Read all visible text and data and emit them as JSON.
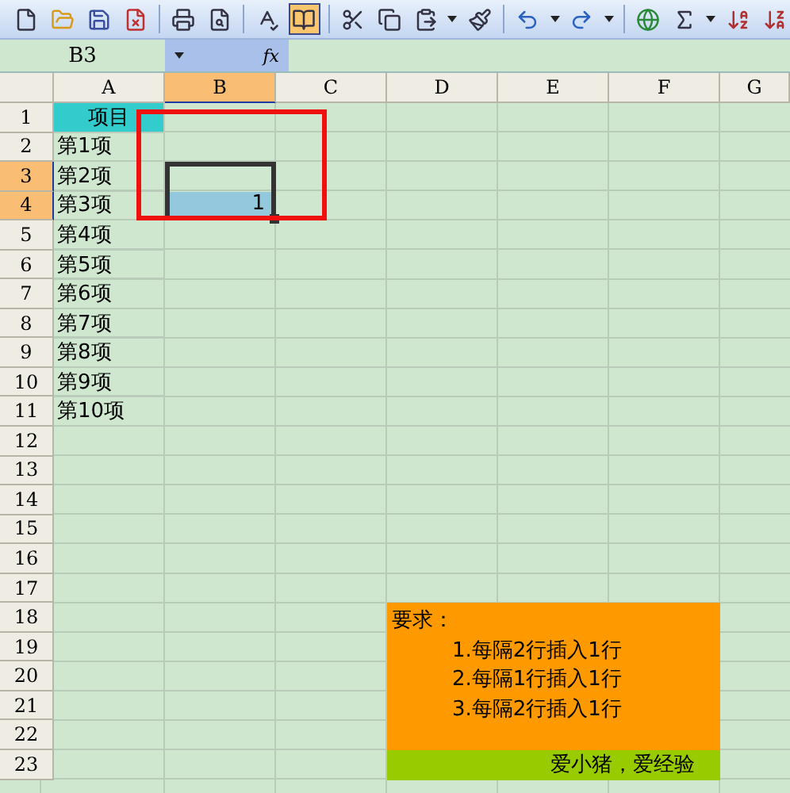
{
  "toolbar": [
    {
      "kind": "new",
      "pressed": false
    },
    {
      "kind": "open",
      "pressed": false
    },
    {
      "kind": "save",
      "pressed": false
    },
    {
      "kind": "permission",
      "pressed": false
    },
    {
      "kind": "separator"
    },
    {
      "kind": "print",
      "pressed": false
    },
    {
      "kind": "preview",
      "pressed": false
    },
    {
      "kind": "separator"
    },
    {
      "kind": "spelling",
      "pressed": false
    },
    {
      "kind": "research",
      "pressed": true
    },
    {
      "kind": "separator"
    },
    {
      "kind": "cut",
      "pressed": false
    },
    {
      "kind": "copy",
      "pressed": false
    },
    {
      "kind": "paste",
      "pressed": false
    },
    {
      "kind": "dropdown"
    },
    {
      "kind": "format_painter",
      "pressed": false
    },
    {
      "kind": "separator"
    },
    {
      "kind": "undo",
      "pressed": false
    },
    {
      "kind": "dropdown"
    },
    {
      "kind": "redo",
      "pressed": false
    },
    {
      "kind": "dropdown"
    },
    {
      "kind": "separator"
    },
    {
      "kind": "hyperlink",
      "pressed": false
    },
    {
      "kind": "autosum",
      "pressed": false
    },
    {
      "kind": "dropdown"
    },
    {
      "kind": "sort_asc",
      "pressed": false
    },
    {
      "kind": "sort_desc",
      "pressed": false
    }
  ],
  "formula_bar": {
    "name_box": "B3",
    "fx": "fx"
  },
  "columns": [
    {
      "label": "A",
      "selected": false
    },
    {
      "label": "B",
      "selected": true
    },
    {
      "label": "C",
      "selected": false
    },
    {
      "label": "D",
      "selected": false
    },
    {
      "label": "E",
      "selected": false
    },
    {
      "label": "F",
      "selected": false
    },
    {
      "label": "G",
      "selected": false
    }
  ],
  "rows": [
    {
      "number": "1",
      "selected": false,
      "a": "项目"
    },
    {
      "number": "2",
      "selected": false,
      "a": "第1项"
    },
    {
      "number": "3",
      "selected": true,
      "a": "第2项"
    },
    {
      "number": "4",
      "selected": true,
      "a": "第3项",
      "b": "1"
    },
    {
      "number": "5",
      "selected": false,
      "a": "第4项"
    },
    {
      "number": "6",
      "selected": false,
      "a": "第5项"
    },
    {
      "number": "7",
      "selected": false,
      "a": "第6项"
    },
    {
      "number": "8",
      "selected": false,
      "a": "第7项"
    },
    {
      "number": "9",
      "selected": false,
      "a": "第8项"
    },
    {
      "number": "10",
      "selected": false,
      "a": "第9项"
    },
    {
      "number": "11",
      "selected": false,
      "a": "第10项"
    },
    {
      "number": "12",
      "selected": false
    },
    {
      "number": "13",
      "selected": false
    },
    {
      "number": "14",
      "selected": false
    },
    {
      "number": "15",
      "selected": false
    },
    {
      "number": "16",
      "selected": false
    },
    {
      "number": "17",
      "selected": false
    },
    {
      "number": "18",
      "selected": false
    },
    {
      "number": "19",
      "selected": false
    },
    {
      "number": "20",
      "selected": false
    },
    {
      "number": "21",
      "selected": false
    },
    {
      "number": "22",
      "selected": false
    },
    {
      "number": "23",
      "selected": false
    }
  ],
  "note": {
    "title": "要求：",
    "items": [
      "1.每隔2行插入1行",
      "2.每隔1行插入1行",
      "3.每隔2行插入1行"
    ],
    "footer": "爱小猪，爱经验"
  }
}
